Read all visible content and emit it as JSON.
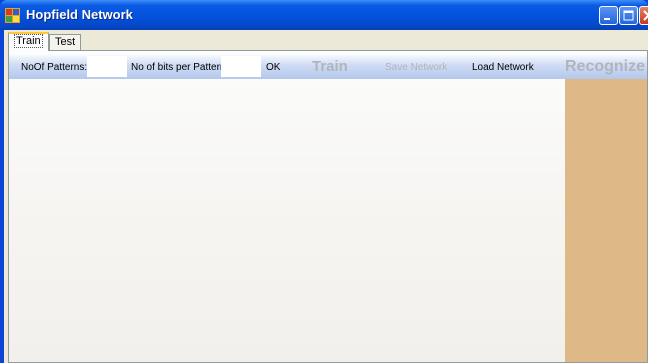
{
  "window": {
    "title": "Hopfield Network"
  },
  "tabs": [
    {
      "label": "Train",
      "active": true
    },
    {
      "label": "Test",
      "active": false
    }
  ],
  "toolbar": {
    "patterns_label": "NoOf Patterns:",
    "patterns_value": "",
    "bits_label": "No of bits per Pattern",
    "bits_value": "",
    "ok_label": "OK",
    "train_label": "Train",
    "save_label": "Save Network",
    "load_label": "Load Network",
    "recognize_label": "Recognize"
  },
  "colors": {
    "titlebar": "#0352dc",
    "client_bg": "#ece9d8",
    "right_panel": "#deb887",
    "disabled_text": "#b0b4bc"
  },
  "icons": [
    "app-icon",
    "minimize-icon",
    "maximize-icon",
    "close-icon"
  ]
}
